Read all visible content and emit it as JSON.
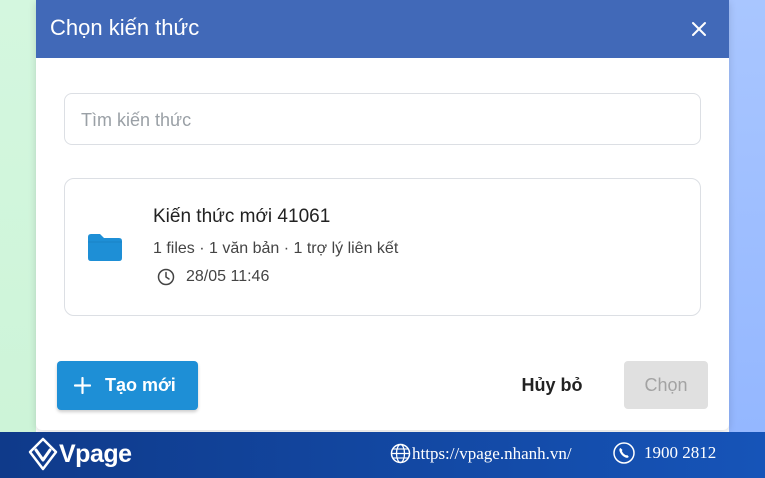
{
  "dialog": {
    "title": "Chọn kiến thức",
    "close_icon": "close-icon",
    "search": {
      "placeholder": "Tìm kiến thức",
      "value": ""
    },
    "knowledge_items": [
      {
        "name": "Kiến thức mới 41061",
        "meta": "1 files · 1 văn bản · 1 trợ lý liên kết",
        "time": "28/05 11:46",
        "icon": "folder-icon",
        "time_icon": "clock-icon"
      }
    ],
    "buttons": {
      "create": "Tạo mới",
      "cancel": "Hủy bỏ",
      "choose": "Chọn"
    }
  },
  "footer": {
    "brand": "Vpage",
    "website": "https://vpage.nhanh.vn/",
    "phone": "1900 2812"
  },
  "colors": {
    "header": "#4169b8",
    "primary_button": "#1e8fd6",
    "folder": "#1e8fd6",
    "disabled_button": "#e0e0e0",
    "footer": "#0f3a8a"
  }
}
